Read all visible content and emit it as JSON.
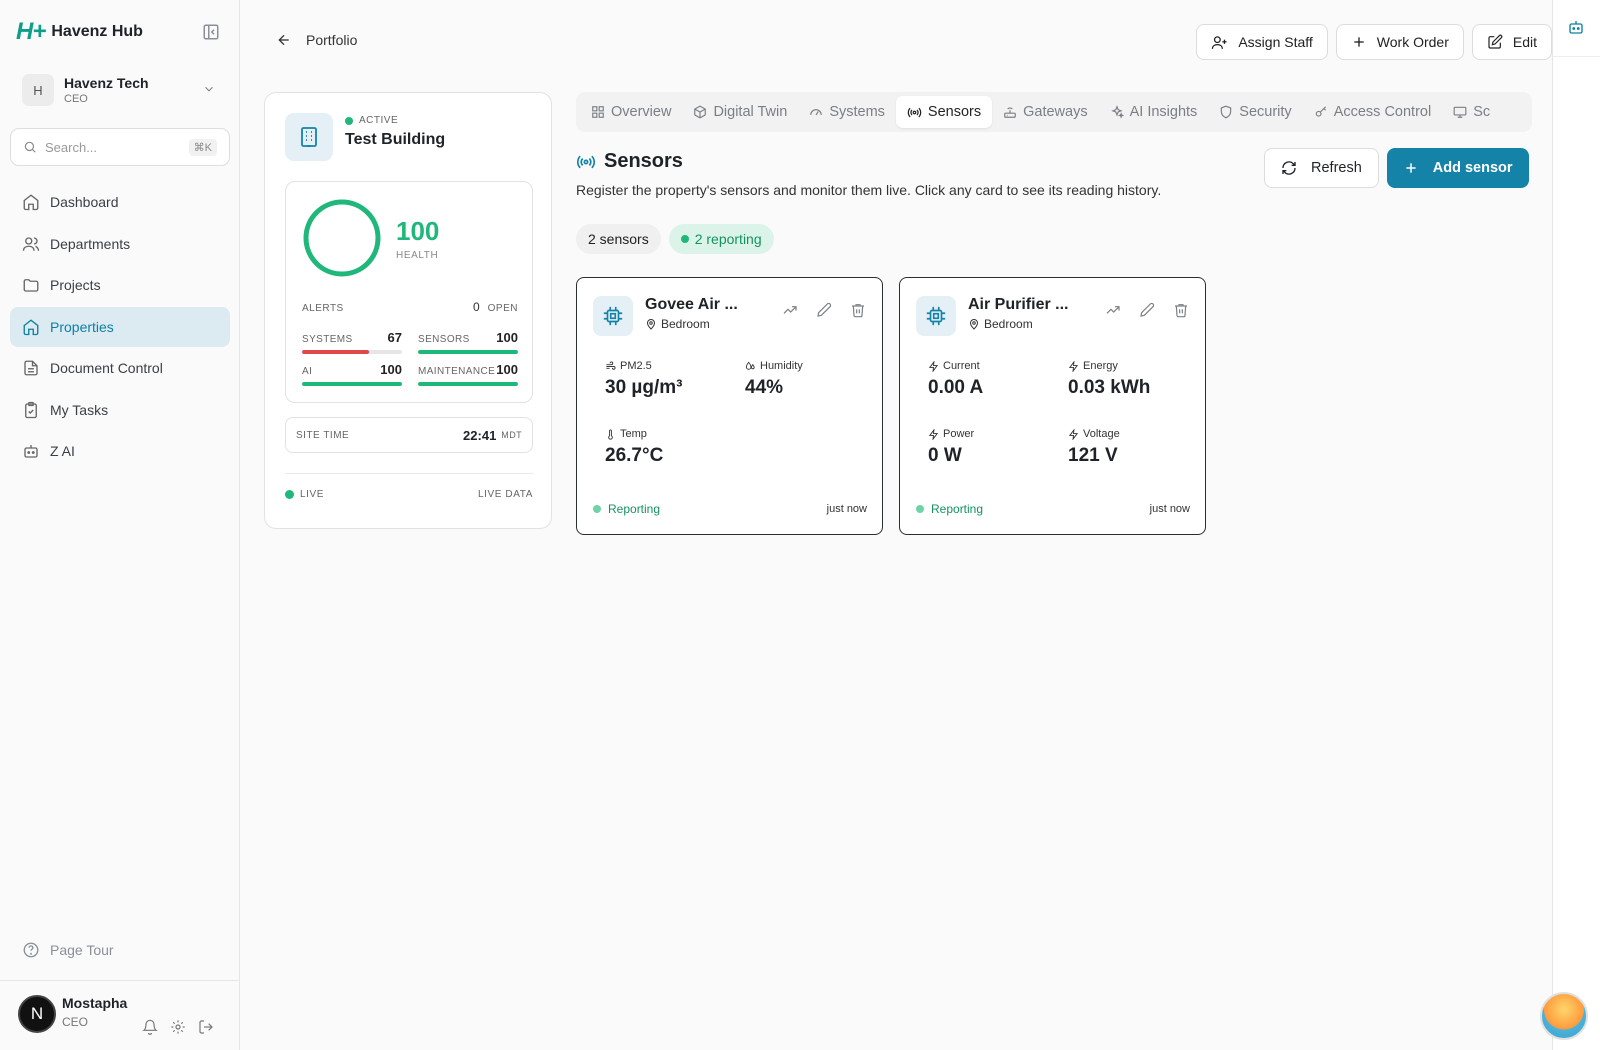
{
  "brand": {
    "logo": "H+",
    "name": "Havenz Hub"
  },
  "org": {
    "avatar": "H",
    "name": "Havenz Tech",
    "role": "CEO"
  },
  "search": {
    "placeholder": "Search...",
    "shortcut": "⌘K"
  },
  "nav": [
    {
      "label": "Dashboard",
      "icon": "home-icon"
    },
    {
      "label": "Departments",
      "icon": "users-icon"
    },
    {
      "label": "Projects",
      "icon": "folder-icon"
    },
    {
      "label": "Properties",
      "icon": "home-icon",
      "active": true
    },
    {
      "label": "Document Control",
      "icon": "document-icon"
    },
    {
      "label": "My Tasks",
      "icon": "clipboard-icon"
    },
    {
      "label": "Z AI",
      "icon": "bot-icon"
    }
  ],
  "tour": {
    "label": "Page Tour"
  },
  "user": {
    "avatar": "N",
    "name": "Mostapha",
    "role": "CEO"
  },
  "header": {
    "back_label": "Portfolio",
    "actions": {
      "assign": "Assign Staff",
      "work_order": "Work Order",
      "edit": "Edit"
    }
  },
  "property": {
    "status": "ACTIVE",
    "title": "Test Building",
    "health_value": "100",
    "health_label": "HEALTH",
    "alerts_label": "ALERTS",
    "alerts_count": "0",
    "alerts_open": "OPEN",
    "metrics": {
      "systems": {
        "label": "SYSTEMS",
        "value": "67",
        "fill": 0.67,
        "color": "#e04848"
      },
      "sensors": {
        "label": "SENSORS",
        "value": "100",
        "fill": 1.0,
        "color": "#1fb77a"
      },
      "ai": {
        "label": "AI",
        "value": "100",
        "fill": 1.0,
        "color": "#1fb77a"
      },
      "maintenance": {
        "label": "MAINTENANCE",
        "value": "100",
        "fill": 1.0,
        "color": "#1fb77a"
      }
    },
    "site_time_label": "SITE TIME",
    "site_time": "22:41",
    "site_tz": "MDT",
    "live_label": "LIVE",
    "live_data_label": "LIVE DATA"
  },
  "tabs": [
    {
      "label": "Overview",
      "icon": "grid-icon"
    },
    {
      "label": "Digital Twin",
      "icon": "cube-icon"
    },
    {
      "label": "Systems",
      "icon": "gauge-icon"
    },
    {
      "label": "Sensors",
      "icon": "radio-icon",
      "active": true
    },
    {
      "label": "Gateways",
      "icon": "router-icon"
    },
    {
      "label": "AI Insights",
      "icon": "sparkles-icon"
    },
    {
      "label": "Security",
      "icon": "shield-icon"
    },
    {
      "label": "Access Control",
      "icon": "key-icon"
    },
    {
      "label": "Sc",
      "icon": "monitor-icon"
    }
  ],
  "section": {
    "title": "Sensors",
    "description": "Register the property's sensors and monitor them live. Click any card to see its reading history.",
    "refresh": "Refresh",
    "add": "Add sensor",
    "count_pill": "2 sensors",
    "reporting_pill": "2 reporting"
  },
  "sensors": [
    {
      "name": "Govee Air ...",
      "location": "Bedroom",
      "readings": [
        {
          "label": "PM2.5",
          "value": "30 µg/m³",
          "icon": "wind-icon"
        },
        {
          "label": "Humidity",
          "value": "44%",
          "icon": "droplets-icon"
        },
        {
          "label": "Temp",
          "value": "26.7°C",
          "icon": "thermometer-icon"
        }
      ],
      "status": "Reporting",
      "updated": "just now"
    },
    {
      "name": "Air Purifier ...",
      "location": "Bedroom",
      "readings": [
        {
          "label": "Current",
          "value": "0.00 A",
          "icon": "bolt-icon"
        },
        {
          "label": "Energy",
          "value": "0.03 kWh",
          "icon": "bolt-icon"
        },
        {
          "label": "Power",
          "value": "0 W",
          "icon": "bolt-icon"
        },
        {
          "label": "Voltage",
          "value": "121 V",
          "icon": "bolt-icon"
        }
      ],
      "status": "Reporting",
      "updated": "just now"
    }
  ]
}
